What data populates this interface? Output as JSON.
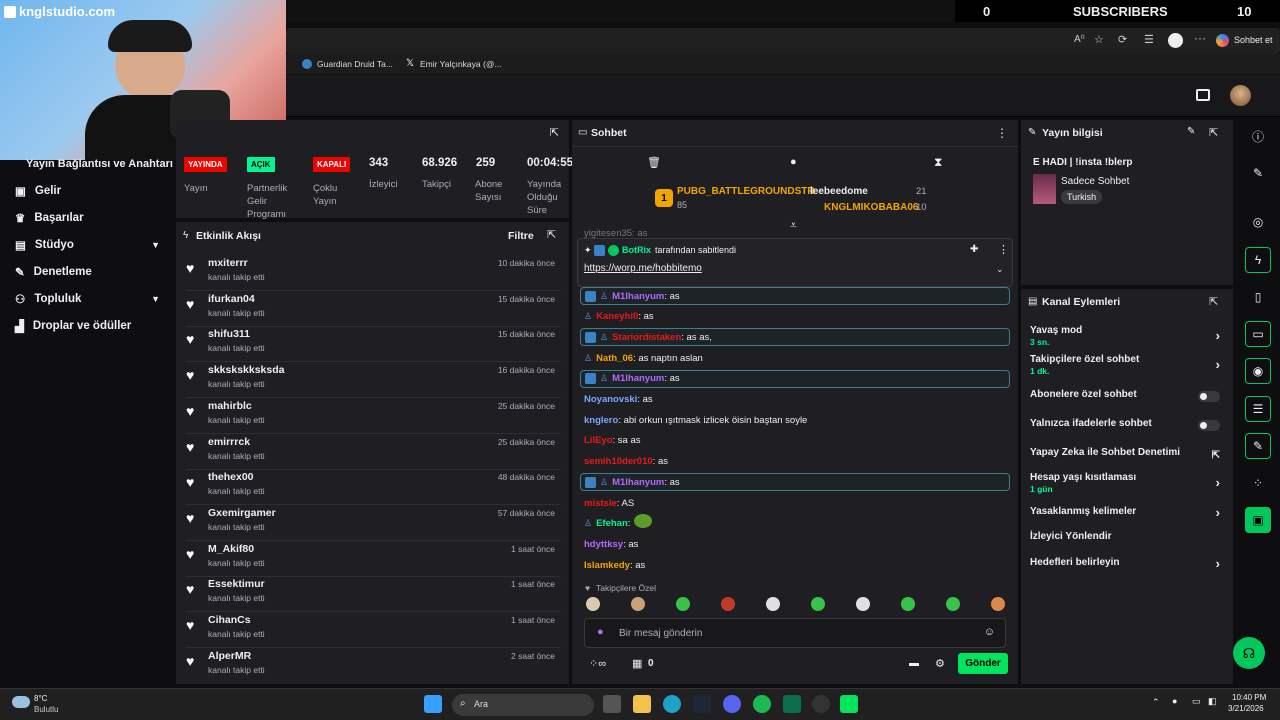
{
  "overlay": {
    "brand": "knglstudio.com",
    "subscribers_label": "SUBSCRIBERS",
    "subs_left": "0",
    "subs_right": "10"
  },
  "browser": {
    "sohbet_label": "Sohbet et",
    "tabs": [
      "Guardian Druid Ta...",
      "Emir Yalçınkaya (@..."
    ]
  },
  "leftnav": {
    "title": "Yayın Bağlantısı ve Anahtarı",
    "items": [
      {
        "label": "Gelir",
        "icon": "money-icon",
        "chevron": false
      },
      {
        "label": "Başarılar",
        "icon": "trophy-icon",
        "chevron": false
      },
      {
        "label": "Stüdyo",
        "icon": "studio-icon",
        "chevron": true
      },
      {
        "label": "Denetleme",
        "icon": "wrench-icon",
        "chevron": false
      },
      {
        "label": "Topluluk",
        "icon": "community-icon",
        "chevron": true
      },
      {
        "label": "Droplar ve ödüller",
        "icon": "drops-icon",
        "chevron": false
      }
    ]
  },
  "stats": {
    "badges": [
      {
        "text": "YAYINDA",
        "color": "#eb0400",
        "label": "Yayın"
      },
      {
        "text": "AÇIK",
        "color": "#00f593",
        "label": "Partnerlik Gelir Programı"
      },
      {
        "text": "KAPALI",
        "color": "#eb0400",
        "label": "Çoklu Yayın"
      }
    ],
    "values": [
      {
        "value": "343",
        "label": "İzleyici"
      },
      {
        "value": "68.926",
        "label": "Takipçi"
      },
      {
        "value": "259",
        "label": "Abone Sayısı"
      },
      {
        "value": "00:04:55",
        "label": "Yayında Olduğu Süre"
      }
    ]
  },
  "activity": {
    "title": "Etkinlik Akışı",
    "filter": "Filtre",
    "events": [
      {
        "name": "mxiterrr",
        "sub": "kanalı takip etti",
        "time": "10 dakika önce"
      },
      {
        "name": "ifurkan04",
        "sub": "kanalı takip etti",
        "time": "15 dakika önce"
      },
      {
        "name": "shifu311",
        "sub": "kanalı takip etti",
        "time": "15 dakika önce"
      },
      {
        "name": "skkskskksksda",
        "sub": "kanalı takip etti",
        "time": "16 dakika önce"
      },
      {
        "name": "mahirblc",
        "sub": "kanalı takip etti",
        "time": "25 dakika önce"
      },
      {
        "name": "emirrrck",
        "sub": "kanalı takip etti",
        "time": "25 dakika önce"
      },
      {
        "name": "thehex00",
        "sub": "kanalı takip etti",
        "time": "48 dakika önce"
      },
      {
        "name": "Gxemirgamer",
        "sub": "kanalı takip etti",
        "time": "57 dakika önce"
      },
      {
        "name": "M_Akif80",
        "sub": "kanalı takip etti",
        "time": "1 saat önce"
      },
      {
        "name": "Essektimur",
        "sub": "kanalı takip etti",
        "time": "1 saat önce"
      },
      {
        "name": "CihanCs",
        "sub": "kanalı takip etti",
        "time": "1 saat önce"
      },
      {
        "name": "AlperMR",
        "sub": "kanalı takip etti",
        "time": "2 saat önce"
      }
    ]
  },
  "chat": {
    "title": "Sohbet",
    "leaderboard": {
      "rank1_name": "PUBG_BATTLEGROUNDSTR",
      "rank1_value": "85",
      "r2_name": "leebeedome",
      "r2_value": "21",
      "r3_name": "KNGLMIKOBABA06",
      "r3_value": "10"
    },
    "partial_top": "yigitesen35: as",
    "pinned": {
      "by": "BotRix",
      "by_suffix": "tarafından sabitlendi",
      "link": "https://worp.me/hobbitemo"
    },
    "messages": [
      {
        "user": "M1lhanyum",
        "color": "#b06bff",
        "text": ": as",
        "hl": true,
        "badges": 2
      },
      {
        "user": "Kaneyhi0",
        "color": "#e91916",
        "text": ": as",
        "hl": false,
        "badges": 1
      },
      {
        "user": "Stariordistaken",
        "color": "#e91916",
        "text": ": as as,",
        "hl": true,
        "badges": 2
      },
      {
        "user": "Nath_06",
        "color": "#f0a500",
        "text": ": as naptın aslan",
        "hl": false,
        "badges": 1
      },
      {
        "user": "M1lhanyum",
        "color": "#b06bff",
        "text": ": as",
        "hl": true,
        "badges": 2
      },
      {
        "user": "Noyanovski",
        "color": "#7aa7ff",
        "text": ": as",
        "hl": false,
        "badges": 0
      },
      {
        "user": "knglero",
        "color": "#7aa7ff",
        "text": ": abi orkun ışıtmask izlicek öisin baştan soyle",
        "hl": false,
        "badges": 0
      },
      {
        "user": "LilEyo",
        "color": "#e91916",
        "text": ": sa as",
        "hl": false,
        "badges": 0
      },
      {
        "user": "semih10der010",
        "color": "#e91916",
        "text": ": as",
        "hl": false,
        "badges": 0
      },
      {
        "user": "M1lhanyum",
        "color": "#b06bff",
        "text": ": as",
        "hl": true,
        "badges": 2
      },
      {
        "user": "mistsie",
        "color": "#e91916",
        "text": ": AS",
        "hl": false,
        "badges": 0
      },
      {
        "user": "Efehan",
        "color": "#00f593",
        "text": ":",
        "hl": false,
        "badges": 1
      },
      {
        "user": "hdyttksy",
        "color": "#b06bff",
        "text": ": as",
        "hl": false,
        "badges": 0
      },
      {
        "user": "Islamkedy",
        "color": "#f0a500",
        "text": ": as",
        "hl": false,
        "badges": 0
      }
    ],
    "follower_only": "Takipçilere Özel",
    "input_placeholder": "Bir mesaj gönderin",
    "points": "0",
    "send": "Gönder"
  },
  "stream_info": {
    "title": "Yayın bilgisi",
    "stream_title": "E HADI | !insta !blerp",
    "category": "Sadece Sohbet",
    "tag": "Turkish"
  },
  "channel_actions": {
    "title": "Kanal Eylemleri",
    "items": [
      {
        "label": "Yavaş mod",
        "sub": "3 sn.",
        "control": "chevron"
      },
      {
        "label": "Takipçilere özel sohbet",
        "sub": "1 dk.",
        "control": "chevron"
      },
      {
        "label": "Abonelere özel sohbet",
        "sub": "",
        "control": "toggle"
      },
      {
        "label": "Yalnızca ifadelerle sohbet",
        "sub": "",
        "control": "toggle"
      },
      {
        "label": "Yapay Zeka ile Sohbet Denetimi",
        "sub": "",
        "control": "external"
      },
      {
        "label": "Hesap yaşı kısıtlaması",
        "sub": "1 gün",
        "control": "chevron"
      },
      {
        "label": "Yasaklanmış kelimeler",
        "sub": "",
        "control": "chevron"
      },
      {
        "label": "İzleyici Yönlendir",
        "sub": "",
        "control": "none"
      },
      {
        "label": "Hedefleri belirleyin",
        "sub": "",
        "control": "chevron"
      }
    ]
  },
  "taskbar": {
    "weather_temp": "8°C",
    "weather_desc": "Bulutlu",
    "search": "Ara",
    "time": "10:40 PM",
    "date": "3/21/2026"
  },
  "colors": {
    "accent": "#00c85c",
    "live": "#eb0400",
    "panel": "#1f1f23"
  }
}
